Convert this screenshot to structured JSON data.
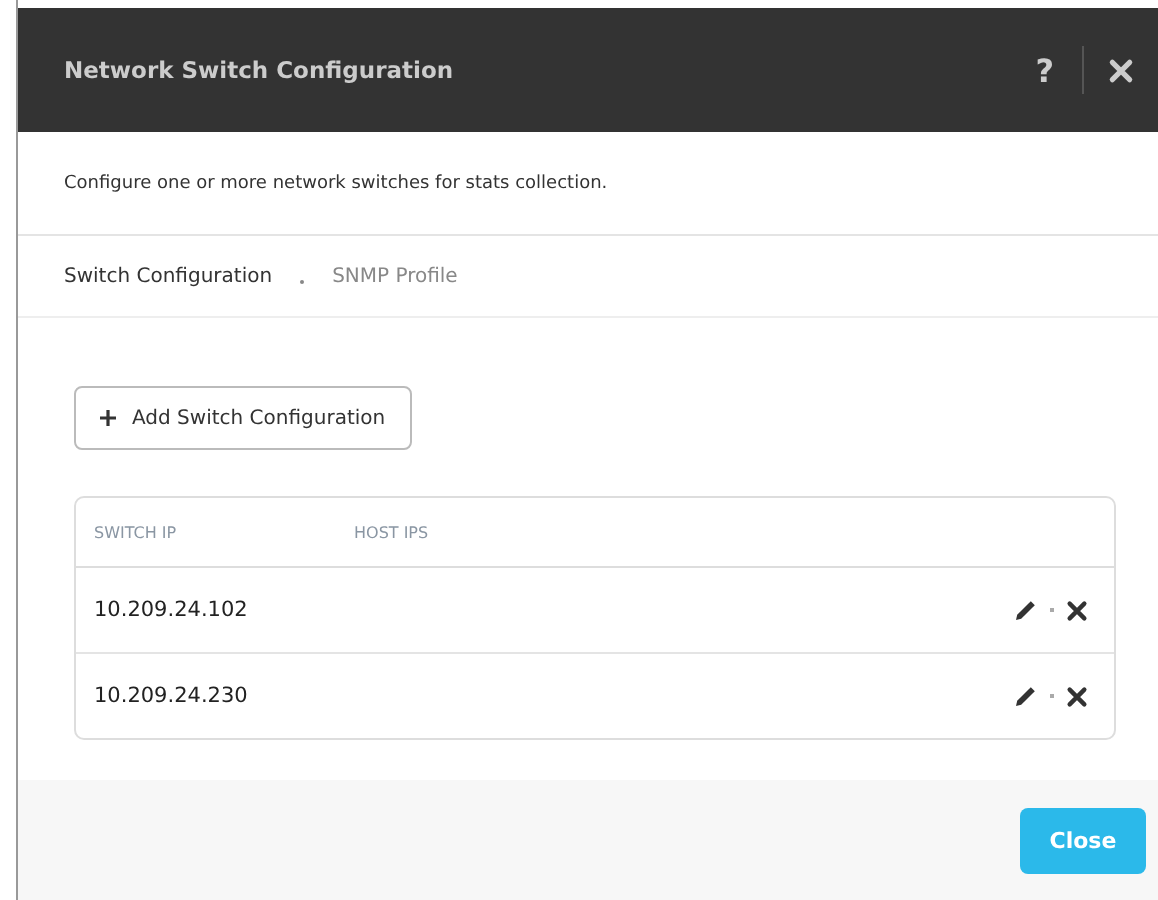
{
  "dialog": {
    "title": "Network Switch Configuration",
    "help_label": "?",
    "description": "Configure one or more network switches for stats collection."
  },
  "tabs": [
    {
      "label": "Switch Configuration",
      "selected": true
    },
    {
      "label": "SNMP Profile",
      "selected": false
    }
  ],
  "add_button": {
    "label": "Add Switch Configuration"
  },
  "table": {
    "columns": [
      "SWITCH IP",
      "HOST IPS"
    ],
    "rows": [
      {
        "switch_ip": "10.209.24.102"
      },
      {
        "switch_ip": "10.209.24.230"
      }
    ]
  },
  "footer": {
    "close_button": "Close"
  }
}
